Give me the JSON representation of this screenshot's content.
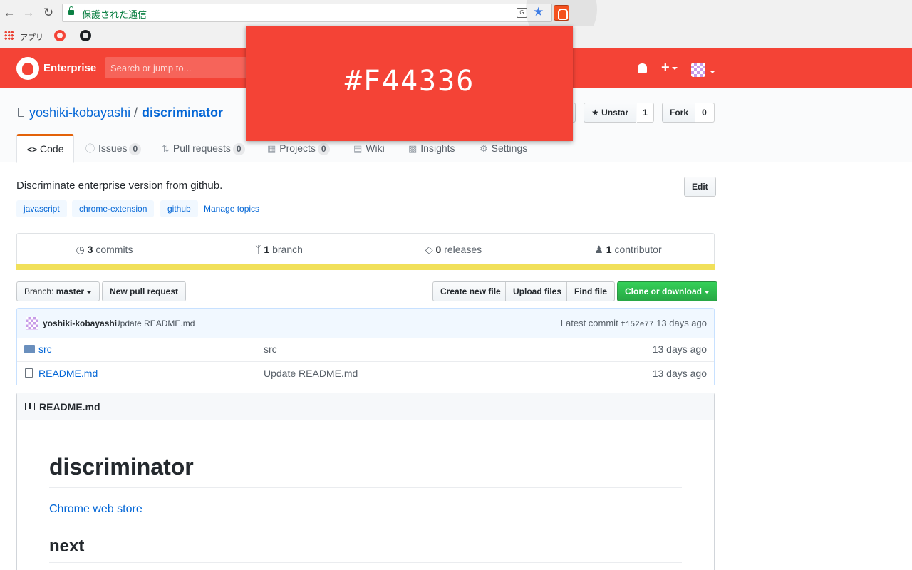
{
  "browser": {
    "back_icon": "back-arrow-icon",
    "forward_icon": "forward-arrow-icon",
    "reload_icon": "reload-icon",
    "secure_label": "保護された通信",
    "bookmarks": {
      "apps_label": "アプリ"
    }
  },
  "header": {
    "brand": "Enterprise",
    "search_placeholder": "Search or jump to...",
    "accent_color": "#f44336"
  },
  "repo": {
    "owner": "yoshiki-kobayashi",
    "separator": "/",
    "name": "discriminator",
    "unstar_label": "Unstar",
    "star_count": "1",
    "fork_label": "Fork",
    "fork_count": "0"
  },
  "tabs": [
    {
      "label": "Code",
      "icon": "<>"
    },
    {
      "label": "Issues",
      "count": "0"
    },
    {
      "label": "Pull requests",
      "count": "0"
    },
    {
      "label": "Projects",
      "count": "0"
    },
    {
      "label": "Wiki"
    },
    {
      "label": "Insights"
    },
    {
      "label": "Settings"
    }
  ],
  "about": {
    "description": "Discriminate enterprise version from github.",
    "edit_label": "Edit",
    "topics": [
      "javascript",
      "chrome-extension",
      "github"
    ],
    "manage_topics": "Manage topics"
  },
  "summary": {
    "commits_num": "3",
    "commits_label": "commits",
    "branch_num": "1",
    "branch_label": "branch",
    "releases_num": "0",
    "releases_label": "releases",
    "contrib_num": "1",
    "contrib_label": "contributor",
    "language_color": "#f1e05a"
  },
  "toolbar": {
    "branch_prefix": "Branch:",
    "branch_name": "master",
    "new_pr": "New pull request",
    "create_file": "Create new file",
    "upload_files": "Upload files",
    "find_file": "Find file",
    "clone": "Clone or download"
  },
  "latest_commit": {
    "author": "yoshiki-kobayashi",
    "message": "Update README.md",
    "prefix": "Latest commit",
    "sha": "f152e77",
    "age": "13 days ago"
  },
  "files": [
    {
      "name": "src",
      "message": "src",
      "age": "13 days ago",
      "kind": "folder"
    },
    {
      "name": "README.md",
      "message": "Update README.md",
      "age": "13 days ago",
      "kind": "file"
    }
  ],
  "readme": {
    "file_label": "README.md",
    "h1": "discriminator",
    "link": "Chrome web store",
    "h2": "next"
  },
  "popup": {
    "color_value": "#F44336"
  }
}
